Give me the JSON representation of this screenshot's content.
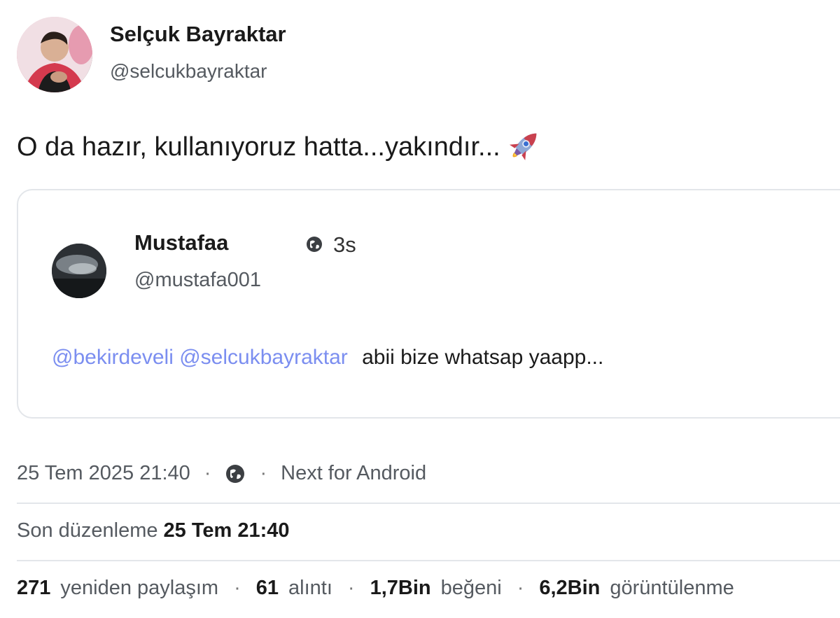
{
  "author": {
    "name": "Selçuk Bayraktar",
    "handle": "@selcukbayraktar"
  },
  "tweet": {
    "text": "O da hazır, kullanıyoruz hatta...yakındır...",
    "emoji_icon": "rocket-icon"
  },
  "quote": {
    "name": "Mustafaa",
    "time": "3s",
    "visibility_icon": "globe-icon",
    "handle": "@mustafa001",
    "mentions": [
      "@bekirdeveli",
      "@selcukbayraktar"
    ],
    "body": "abii bize whatsap yaapp...",
    "mention_color": "#7b8ef0"
  },
  "meta": {
    "date": "25 Tem 2025 21:40",
    "separator": "·",
    "visibility_icon": "globe-icon",
    "client": "Next for Android"
  },
  "edit": {
    "label": "Son düzenleme",
    "value": "25 Tem 21:40"
  },
  "stats": {
    "reposts_count": "271",
    "reposts_label": "yeniden paylaşım",
    "quotes_count": "61",
    "quotes_label": "alıntı",
    "likes_count": "1,7Bin",
    "likes_label": "beğeni",
    "views_count": "6,2Bin",
    "views_label": "görüntülenme"
  }
}
